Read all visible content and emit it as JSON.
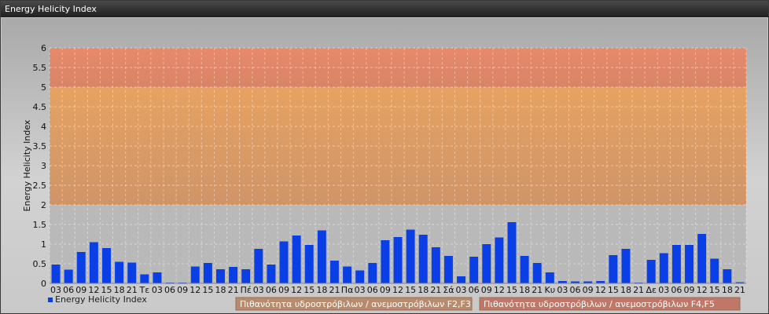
{
  "window": {
    "title": "Energy Helicity Index"
  },
  "chart_data": {
    "type": "bar",
    "title": "Energy Helicity Index",
    "ylabel": "Energy Helicity Index",
    "ylim": [
      0,
      6
    ],
    "yticks": [
      "0",
      "0.5",
      "1",
      "1.5",
      "2",
      "2.5",
      "3",
      "3.5",
      "4",
      "4.5",
      "5",
      "5.5",
      "6"
    ],
    "grid": true,
    "bar_color": "#0a3fe6",
    "categories": [
      "03",
      "06",
      "09",
      "12",
      "15",
      "18",
      "21",
      "Τε",
      "03",
      "06",
      "09",
      "12",
      "15",
      "18",
      "21",
      "Πέ",
      "03",
      "06",
      "09",
      "12",
      "15",
      "18",
      "21",
      "Πα",
      "03",
      "06",
      "09",
      "12",
      "15",
      "18",
      "21",
      "Σά",
      "03",
      "06",
      "09",
      "12",
      "15",
      "18",
      "21",
      "Κυ",
      "03",
      "06",
      "09",
      "12",
      "15",
      "18",
      "21",
      "Δε",
      "03",
      "06",
      "09",
      "12",
      "15",
      "18",
      "21"
    ],
    "series": [
      {
        "name": "Energy Helicity Index",
        "values": [
          0.48,
          0.35,
          0.8,
          1.05,
          0.9,
          0.55,
          0.53,
          0.23,
          0.28,
          0.02,
          0.02,
          0.43,
          0.52,
          0.36,
          0.42,
          0.36,
          0.88,
          0.48,
          1.07,
          1.22,
          0.98,
          1.35,
          0.58,
          0.43,
          0.33,
          0.52,
          1.1,
          1.18,
          1.37,
          1.24,
          0.92,
          0.7,
          0.18,
          0.68,
          1.0,
          1.17,
          1.56,
          0.7,
          0.52,
          0.28,
          0.06,
          0.05,
          0.05,
          0.06,
          0.72,
          0.88,
          0.02,
          0.6,
          0.77,
          0.98,
          0.98,
          1.26,
          0.63,
          0.36,
          0.03
        ]
      }
    ],
    "bands": [
      {
        "from": 2,
        "to": 5,
        "color": "#e0a060",
        "label": "Πιθανότητα υδροστρόβιλων / ανεμοστρόβιλων F2,F3",
        "legend_color": "#b98b6e"
      },
      {
        "from": 5,
        "to": 6,
        "color": "#e38868",
        "label": "Πιθανότητα υδροστρόβιλων / ανεμοστρόβιλων F4,F5",
        "legend_color": "#bf7868"
      }
    ],
    "legend": {
      "position": "bottom-left",
      "series_label": "Energy Helicity Index"
    }
  }
}
